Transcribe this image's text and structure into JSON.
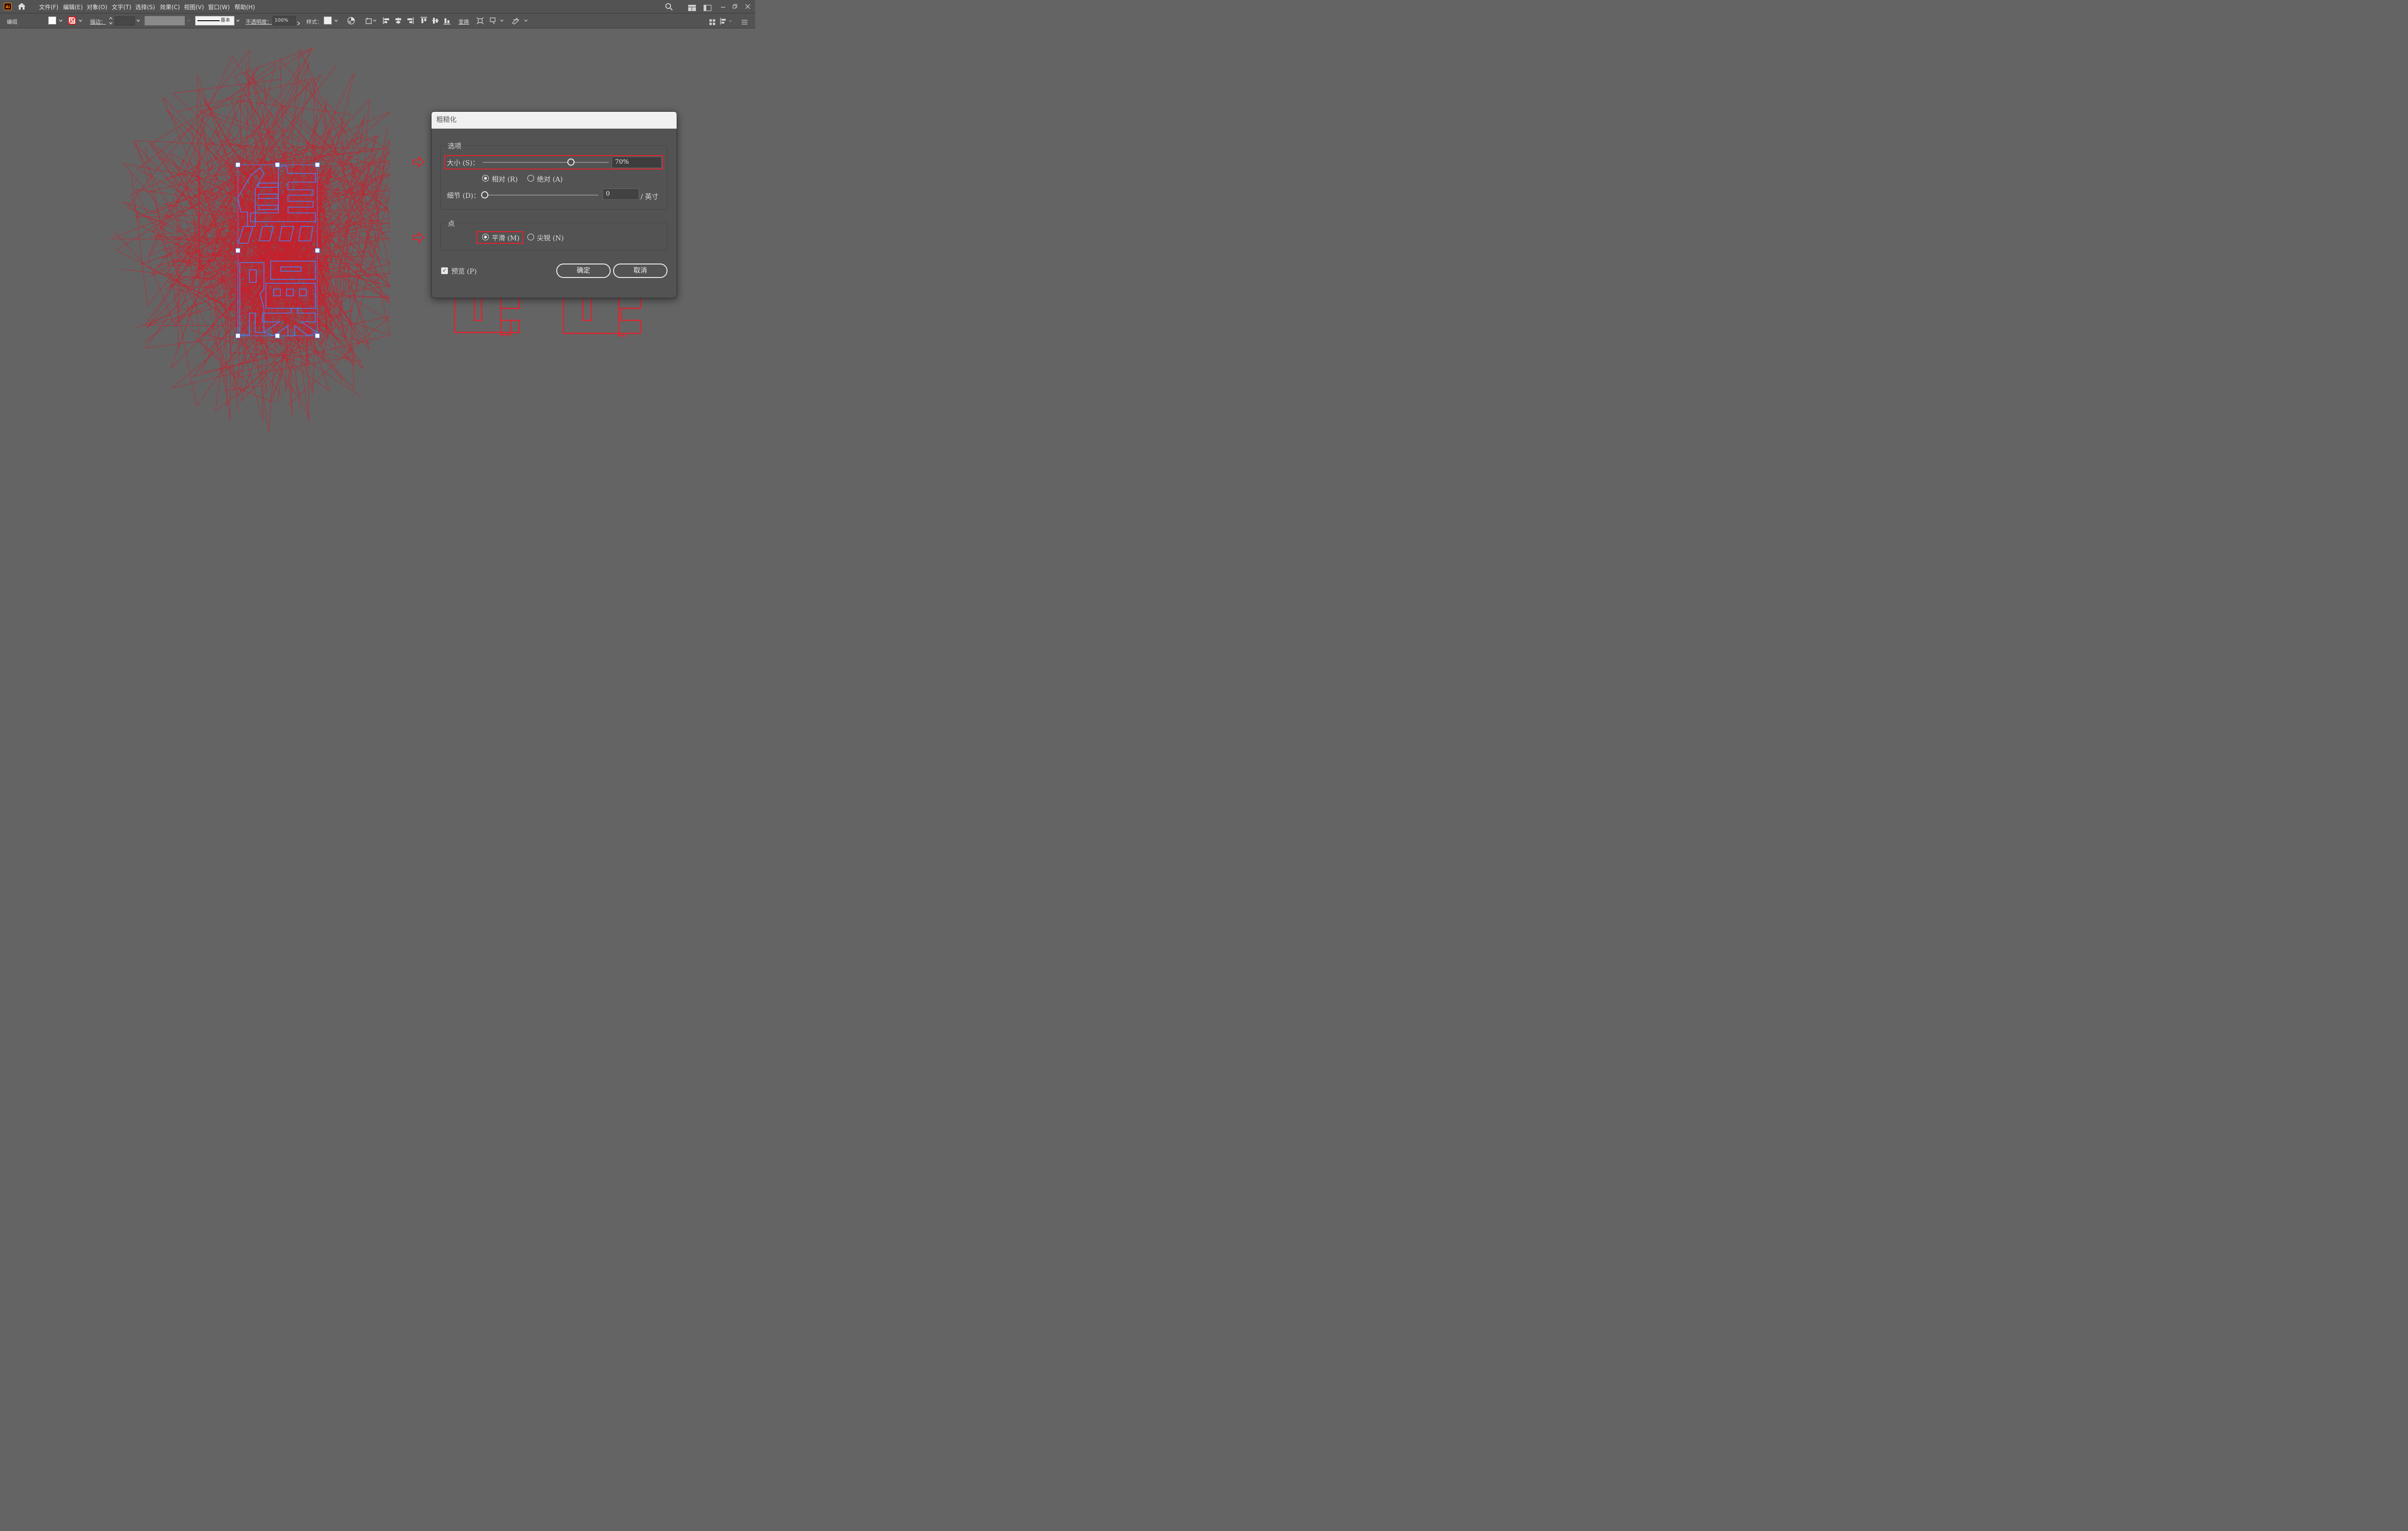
{
  "app": {
    "logo": "Ai"
  },
  "menu": [
    {
      "label": "文件(F)"
    },
    {
      "label": "编辑(E)"
    },
    {
      "label": "对象(O)"
    },
    {
      "label": "文字(T)"
    },
    {
      "label": "选择(S)"
    },
    {
      "label": "效果(C)"
    },
    {
      "label": "视图(V)"
    },
    {
      "label": "窗口(W)"
    },
    {
      "label": "帮助(H)"
    }
  ],
  "controlbar": {
    "selection_label": "编组",
    "stroke_label": "描边：",
    "brush_label": "基本",
    "opacity_label": "不透明度：",
    "opacity_value": "100%",
    "style_label": "样式：",
    "transform_label": "变换"
  },
  "dialog": {
    "title": "粗糙化",
    "options_label": "选项",
    "size_label": "大小 (S)：",
    "size_value": "70%",
    "size_slider_fraction": 0.7,
    "relative_label": "相对 (R)",
    "absolute_label": "绝对 (A)",
    "relative_selected": true,
    "detail_label": "细节 (D)：",
    "detail_value": "0",
    "detail_unit": "/ 英寸",
    "points_label": "点",
    "smooth_label": "平滑 (M)",
    "corner_label": "尖锐 (N)",
    "smooth_selected": true,
    "preview_label": "预览 (P)",
    "preview_checked": true,
    "ok_label": "确定",
    "cancel_label": "取消"
  },
  "colors": {
    "highlight_red": "#e0232e",
    "selection_blue": "#4a7ff0",
    "rough_red": "#c8202c"
  }
}
